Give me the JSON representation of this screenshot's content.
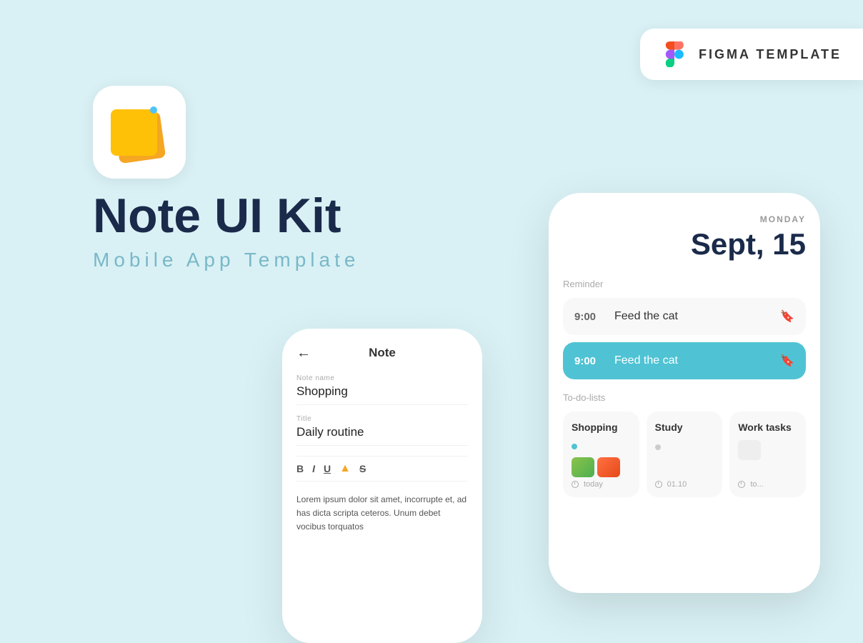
{
  "background_color": "#d9f1f5",
  "figma_badge": {
    "text": "FIGMA TEMPLATE"
  },
  "app_icon": {
    "alt": "Note App Icon"
  },
  "hero": {
    "title": "Note UI Kit",
    "subtitle": "Mobile App Template"
  },
  "phone_main": {
    "day": "MONDAY",
    "date": "Sept, 15",
    "reminder_label": "Reminder",
    "reminders": [
      {
        "time": "9:00",
        "text": "Feed the cat",
        "active": false
      },
      {
        "time": "9:00",
        "text": "Feed the cat",
        "active": true
      }
    ],
    "todo_label": "To-do-lists",
    "todo_cards": [
      {
        "title": "Shopping",
        "footer": "today",
        "has_images": true
      },
      {
        "title": "Study",
        "footer": "01.10",
        "has_images": false
      },
      {
        "title": "Work tasks",
        "footer": "to...",
        "has_images": false
      }
    ]
  },
  "phone_note": {
    "header": "Note",
    "note_name_label": "Note name",
    "note_name_value": "Shopping",
    "title_label": "Title",
    "title_value": "Daily routine",
    "toolbar_buttons": [
      "B",
      "I",
      "U",
      "⬤",
      "S"
    ],
    "body_text": "Lorem ipsum dolor sit amet, incorrupte et, ad has dicta scripta ceteros. Unum debet vocibus torquatos"
  }
}
